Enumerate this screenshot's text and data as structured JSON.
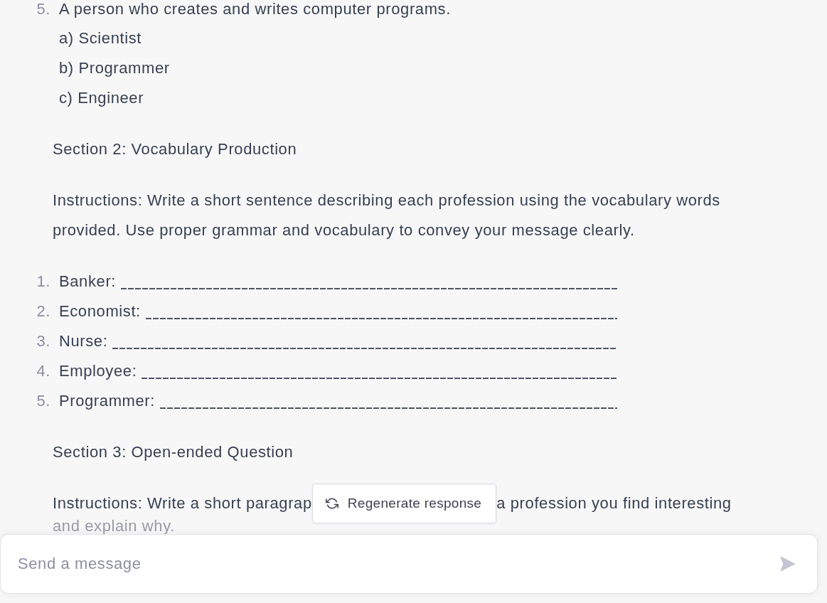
{
  "quiz_question": {
    "number": "5.",
    "text": "A person who creates and writes computer programs.",
    "options": [
      "a) Scientist",
      "b) Programmer",
      "c) Engineer"
    ]
  },
  "section_2": {
    "heading": "Section 2: Vocabulary Production",
    "instructions": "Instructions: Write a short sentence describing each profession using the vocabulary words provided. Use proper grammar and vocabulary to convey your message clearly.",
    "items": [
      {
        "number": "1.",
        "label": "Banker:"
      },
      {
        "number": "2.",
        "label": "Economist:"
      },
      {
        "number": "3.",
        "label": "Nurse:"
      },
      {
        "number": "4.",
        "label": "Employee:"
      },
      {
        "number": "5.",
        "label": "Programmer:"
      }
    ]
  },
  "section_3": {
    "heading": "Section 3: Open-ended Question",
    "instructions_parts": [
      "Instructions: Write a short paragrap",
      "a profession you find interesting",
      "and explain why."
    ]
  },
  "regenerate_button": {
    "label": "Regenerate response"
  },
  "message_input": {
    "placeholder": "Send a message"
  },
  "send_button": {
    "disabled": true
  }
}
